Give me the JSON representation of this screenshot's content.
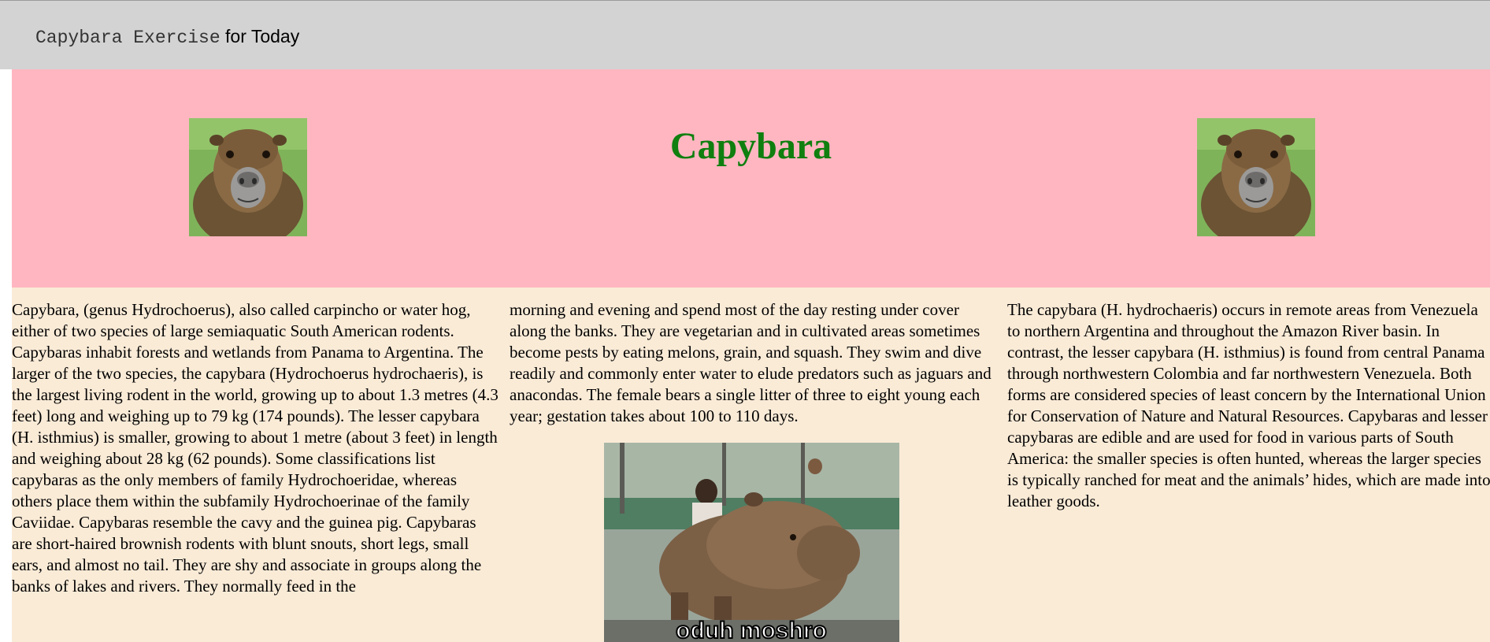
{
  "header": {
    "title_mono": "Capybara Exercise",
    "title_rest": " for Today"
  },
  "hero": {
    "title": "Capybara",
    "color": "#008000",
    "background": "#ffb6c1"
  },
  "article": {
    "background": "#faebd7",
    "col1": "Capybara, (genus Hydrochoerus), also called carpincho or water hog, either of two species of large semiaquatic South American rodents. Capybaras inhabit forests and wetlands from Panama to Argentina. The larger of the two species, the capybara (Hydrochoerus hydrochaeris), is the largest living rodent in the world, growing up to about 1.3 metres (4.3 feet) long and weighing up to 79 kg (174 pounds). The lesser capybara (H. isthmius) is smaller, growing to about 1 metre (about 3 feet) in length and weighing about 28 kg (62 pounds). Some classifications list capybaras as the only members of family Hydrochoeridae, whereas others place them within the subfamily Hydrochoerinae of the family Caviidae. Capybaras resemble the cavy and the guinea pig. Capybaras are short-haired brownish rodents with blunt snouts, short legs, small ears, and almost no tail. They are shy and associate in groups along the banks of lakes and rivers. They normally feed in the",
    "col2": "morning and evening and spend most of the day resting under cover along the banks. They are vegetarian and in cultivated areas sometimes become pests by eating melons, grain, and squash. They swim and dive readily and commonly enter water to elude predators such as jaguars and anacondas. The female bears a single litter of three to eight young each year; gestation takes about 100 to 110 days.",
    "col3": "The capybara (H. hydrochaeris) occurs in remote areas from Venezuela to northern Argentina and throughout the Amazon River basin. In contrast, the lesser capybara (H. isthmius) is found from central Panama through northwestern Colombia and far northwestern Venezuela. Both forms are considered species of least concern by the International Union for Conservation of Nature and Natural Resources. Capybaras and lesser capybaras are edible and are used for food in various parts of South America: the smaller species is often hunted, whereas the larger species is typically ranched for meat and the animals’ hides, which are made into leather goods."
  },
  "meme": {
    "caption": "oduh moshro"
  }
}
